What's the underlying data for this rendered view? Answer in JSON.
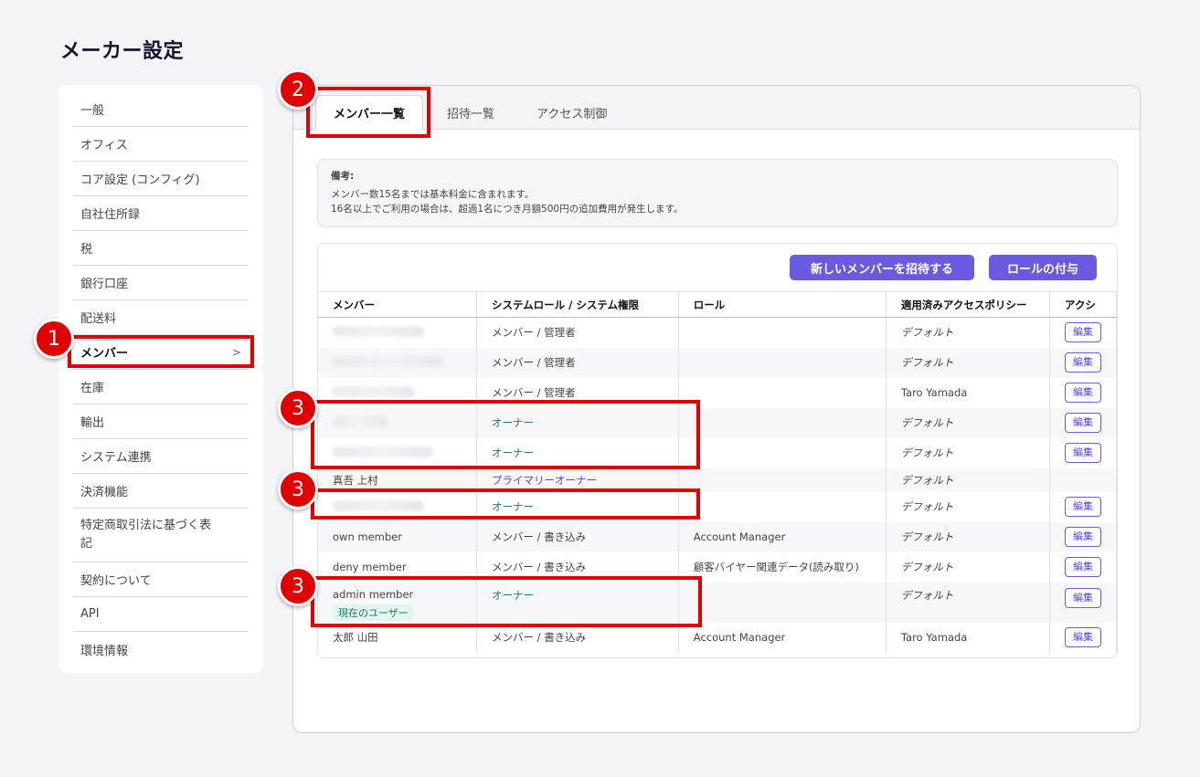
{
  "page_title": "メーカー設定",
  "sidebar": {
    "items": [
      {
        "label": "一般"
      },
      {
        "label": "オフィス"
      },
      {
        "label": "コア設定 (コンフィグ)"
      },
      {
        "label": "自社住所録"
      },
      {
        "label": "税"
      },
      {
        "label": "銀行口座"
      },
      {
        "label": "配送料"
      },
      {
        "label": "メンバー",
        "chevron": ">"
      },
      {
        "label": "在庫"
      },
      {
        "label": "輸出"
      },
      {
        "label": "システム連携"
      },
      {
        "label": "決済機能"
      },
      {
        "label": "特定商取引法に基づく表記"
      },
      {
        "label": "契約について"
      },
      {
        "label": "API"
      },
      {
        "label": "環境情報"
      }
    ]
  },
  "tabs": [
    {
      "label": "メンバー一覧"
    },
    {
      "label": "招待一覧"
    },
    {
      "label": "アクセス制御"
    }
  ],
  "note": {
    "title": "備考:",
    "line1": "メンバー数15名までは基本料金に含まれます。",
    "line2": "16名以上でご利用の場合は、超過1名につき月額500円の追加費用が発生します。"
  },
  "buttons": {
    "invite": "新しいメンバーを招待する",
    "assign_role": "ロールの付与"
  },
  "table": {
    "headers": [
      "メンバー",
      "システムロール / システム権限",
      "ロール",
      "適用済みアクセスポリシー",
      "アクシ"
    ],
    "edit_label": "編集",
    "current_user_badge": "現在のユーザー",
    "rows": [
      {
        "member": "",
        "system_role": "メンバー / 管理者",
        "role": "",
        "policy": "デフォルト"
      },
      {
        "member": "",
        "system_role": "メンバー / 管理者",
        "role": "",
        "policy": "デフォルト"
      },
      {
        "member": "",
        "system_role": "メンバー / 管理者",
        "role": "",
        "policy": "Taro Yamada"
      },
      {
        "member": "",
        "system_role": "オーナー",
        "role": "",
        "policy": "デフォルト"
      },
      {
        "member": "",
        "system_role": "オーナー",
        "role": "",
        "policy": "デフォルト"
      },
      {
        "member": "真吾 上村",
        "system_role": "プライマリーオーナー",
        "role": "",
        "policy": "デフォルト"
      },
      {
        "member": "",
        "system_role": "オーナー",
        "role": "",
        "policy": "デフォルト"
      },
      {
        "member": "own member",
        "system_role": "メンバー / 書き込み",
        "role": "Account Manager",
        "policy": "デフォルト"
      },
      {
        "member": "deny member",
        "system_role": "メンバー / 書き込み",
        "role": "顧客バイヤー関連データ(読み取り)",
        "policy": "デフォルト"
      },
      {
        "member": "admin member",
        "system_role": "オーナー",
        "role": "",
        "policy": "デフォルト"
      },
      {
        "member": "太郎 山田",
        "system_role": "メンバー / 書き込み",
        "role": "Account Manager",
        "policy": "Taro Yamada"
      }
    ]
  },
  "annotations": {
    "m1": "1",
    "m2": "2",
    "m3": "3"
  },
  "colors": {
    "accent": "#6a5ae0",
    "annotation_red": "#e00000",
    "owner_green": "#1f7a6a",
    "primary_purple": "#5a3fd6"
  }
}
